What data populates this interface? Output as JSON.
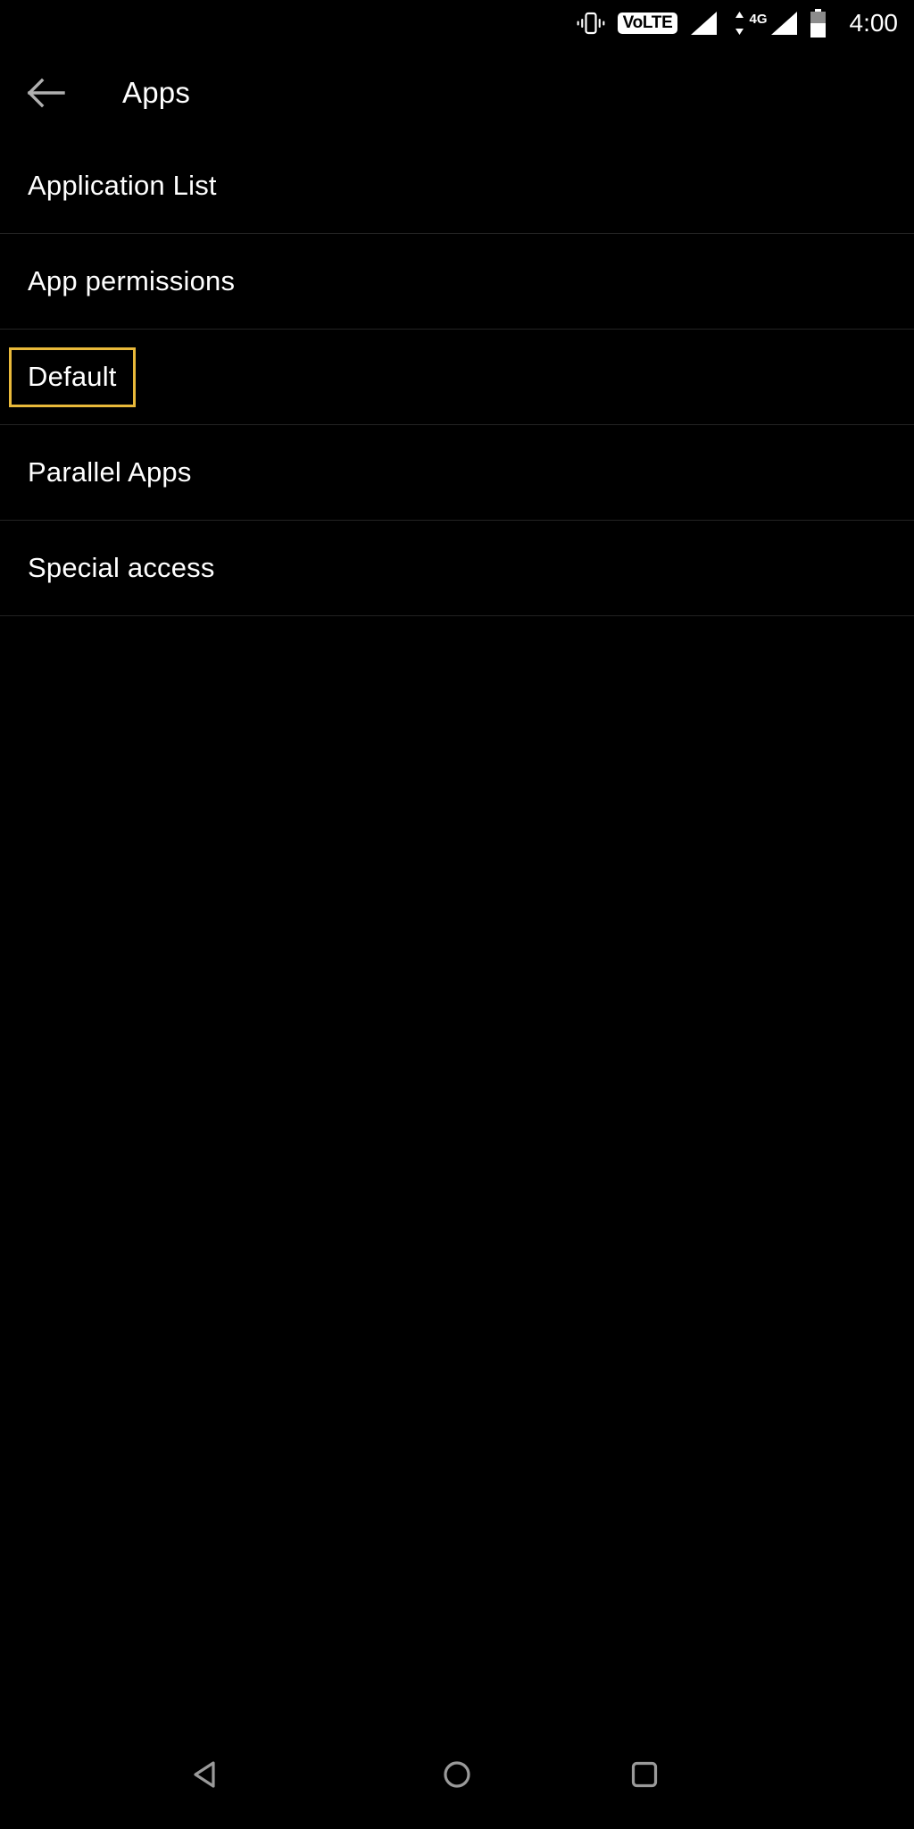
{
  "status_bar": {
    "vibrate_icon": "vibrate-icon",
    "volte_label": "LTE",
    "volte_prefix": "Vo",
    "signal_icon": "signal-bars-icon",
    "data_arrows_icon": "data-transfer-arrows-icon",
    "network_generation": "4G",
    "signal_icon_2": "signal-bars-icon",
    "battery_icon": "battery-half-icon",
    "clock": "4:00"
  },
  "app_bar": {
    "back_icon": "arrow-left-icon",
    "title": "Apps"
  },
  "list": {
    "items": [
      {
        "label": "Application List",
        "focused": false
      },
      {
        "label": "App permissions",
        "focused": false
      },
      {
        "label": "Default",
        "focused": true
      },
      {
        "label": "Parallel Apps",
        "focused": false
      },
      {
        "label": "Special access",
        "focused": false
      }
    ]
  },
  "nav_bar": {
    "back_label": "Back",
    "home_label": "Home",
    "recents_label": "Recents"
  },
  "colors": {
    "background": "#000000",
    "text": "#ffffff",
    "focus_outline": "#e9b93a",
    "divider": "#232323",
    "nav_icon": "#9a9a9a"
  }
}
